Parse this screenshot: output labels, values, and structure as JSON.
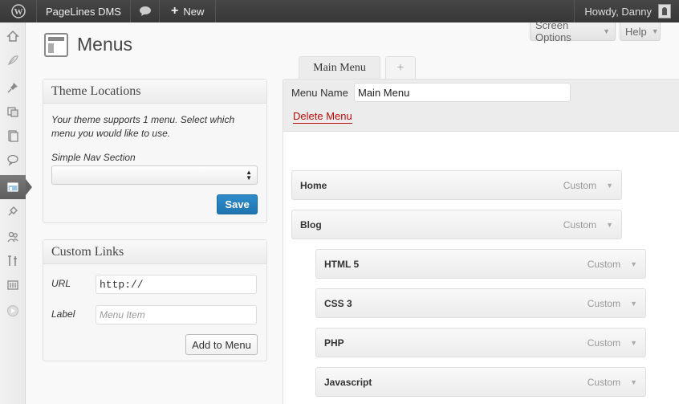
{
  "admin_bar": {
    "site_name": "PageLines DMS",
    "new_label": "New",
    "greeting": "Howdy, Danny"
  },
  "side_menu": [
    {
      "icon": "dashboard-icon",
      "active": false
    },
    {
      "icon": "dms-leaf-icon",
      "active": false
    },
    {
      "icon": "pin-icon",
      "active": false
    },
    {
      "icon": "media-icon",
      "active": false
    },
    {
      "icon": "pages-icon",
      "active": false
    },
    {
      "icon": "comments-icon",
      "active": false
    },
    {
      "icon": "appearance-icon",
      "active": true
    },
    {
      "icon": "plugins-icon",
      "active": false
    },
    {
      "icon": "users-icon",
      "active": false
    },
    {
      "icon": "tools-icon",
      "active": false
    },
    {
      "icon": "settings-icon",
      "active": false
    },
    {
      "icon": "collapse-icon",
      "active": false
    }
  ],
  "header": {
    "page_title": "Menus",
    "screen_options": "Screen Options",
    "help": "Help"
  },
  "theme_locations": {
    "title": "Theme Locations",
    "description": "Your theme supports 1 menu. Select which menu you would like to use.",
    "select_label": "Simple Nav Section",
    "select_value": "",
    "save_label": "Save"
  },
  "custom_links": {
    "title": "Custom Links",
    "url_label": "URL",
    "url_value": "http://",
    "label_label": "Label",
    "label_placeholder": "Menu Item",
    "add_label": "Add to Menu"
  },
  "editor": {
    "tabs": [
      {
        "label": "Main Menu"
      },
      {
        "label": "+"
      }
    ],
    "menu_name_label": "Menu Name",
    "menu_name_value": "Main Menu",
    "delete_label": "Delete Menu",
    "items": [
      {
        "title": "Home",
        "type": "Custom",
        "depth": 0
      },
      {
        "title": "Blog",
        "type": "Custom",
        "depth": 0
      },
      {
        "title": "HTML 5",
        "type": "Custom",
        "depth": 1
      },
      {
        "title": "CSS 3",
        "type": "Custom",
        "depth": 1
      },
      {
        "title": "PHP",
        "type": "Custom",
        "depth": 1
      },
      {
        "title": "Javascript",
        "type": "Custom",
        "depth": 1
      }
    ]
  },
  "colors": {
    "admin_bar": "#464646",
    "primary_button": "#2384c6",
    "delete_link": "#bc0b0b",
    "active_menu": "#6d6d6d"
  }
}
